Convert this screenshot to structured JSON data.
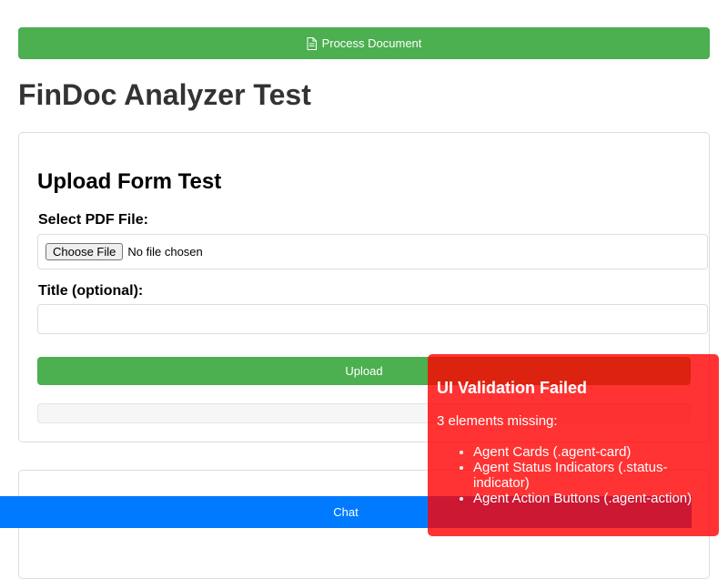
{
  "toolbar": {
    "process_label": "Process Document",
    "process_icon": "document-icon"
  },
  "page": {
    "title": "FinDoc Analyzer Test"
  },
  "upload_form": {
    "title": "Upload Form Test",
    "file_label": "Select PDF File:",
    "choose_file_label": "Choose File",
    "file_status": "No file chosen",
    "title_label": "Title (optional):",
    "title_value": "",
    "upload_label": "Upload"
  },
  "chat": {
    "label": "Chat"
  },
  "validation": {
    "title": "UI Validation Failed",
    "summary": "3 elements missing:",
    "items": [
      "Agent Cards (.agent-card)",
      "Agent Status Indicators (.status-indicator)",
      "Agent Action Buttons (.agent-action)"
    ]
  },
  "colors": {
    "primary_green": "#4caf50",
    "chat_blue": "#007bff",
    "error_red": "#ff0000"
  }
}
